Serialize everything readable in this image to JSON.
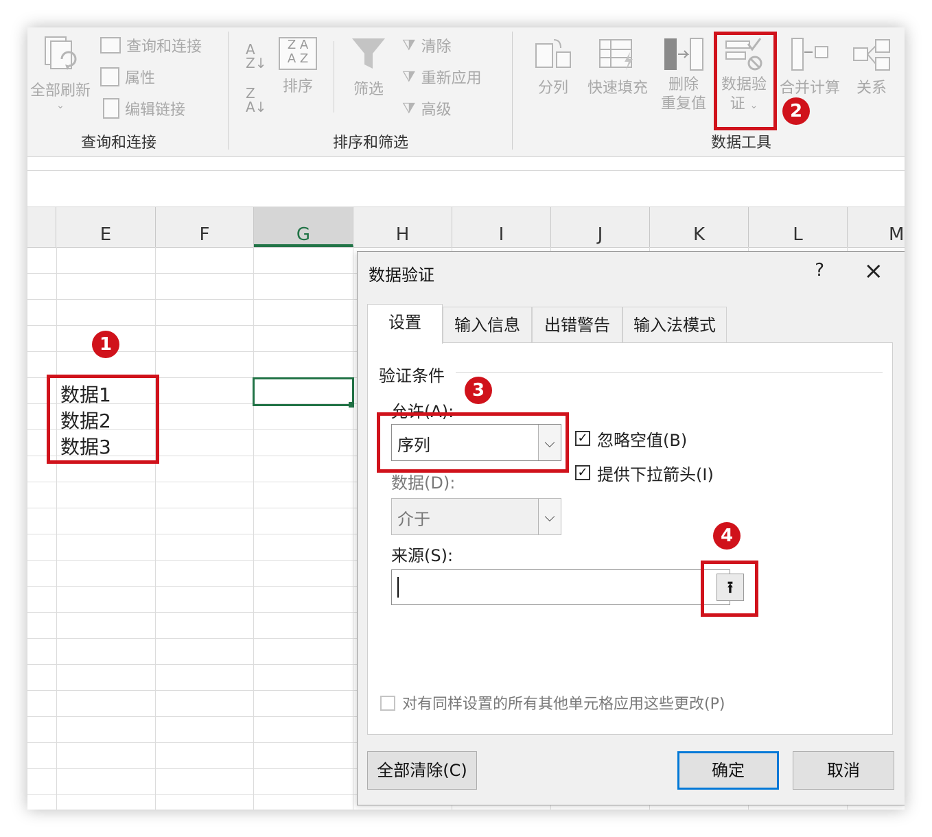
{
  "ribbon": {
    "groups": {
      "query": "查询和连接",
      "sort_filter": "排序和筛选",
      "data_tools": "数据工具"
    },
    "buttons": {
      "refresh_all": "全部刷新",
      "queries_connections": "查询和连接",
      "properties": "属性",
      "edit_links": "编辑链接",
      "sort": "排序",
      "filter": "筛选",
      "clear": "清除",
      "reapply": "重新应用",
      "advanced": "高级",
      "text_to_columns": "分列",
      "flash_fill": "快速填充",
      "remove_dup_1": "删除",
      "remove_dup_2": "重复值",
      "data_validation_1": "数据验",
      "data_validation_2": "证",
      "consolidate": "合并计算",
      "relationships": "关系"
    }
  },
  "columns": [
    "E",
    "F",
    "G",
    "H",
    "I",
    "J",
    "K",
    "L",
    "M"
  ],
  "cells": {
    "e1": "数据1",
    "e2": "数据2",
    "e3": "数据3"
  },
  "badges": [
    "1",
    "2",
    "3",
    "4"
  ],
  "dialog": {
    "title": "数据验证",
    "help": "?",
    "close": "×",
    "tabs": [
      "设置",
      "输入信息",
      "出错警告",
      "输入法模式"
    ],
    "section": "验证条件",
    "allow_label": "允许(A):",
    "allow_value": "序列",
    "ignore_blank": "忽略空值(B)",
    "dropdown_arrow": "提供下拉箭头(I)",
    "data_label": "数据(D):",
    "data_value": "介于",
    "source_label": "来源(S):",
    "source_value": "",
    "apply_all": "对有同样设置的所有其他单元格应用这些更改(P)",
    "clear_all": "全部清除(C)",
    "ok": "确定",
    "cancel": "取消"
  },
  "colors": {
    "highlight": "#d0121b",
    "excel_green": "#217346",
    "focus_blue": "#0078d7"
  }
}
